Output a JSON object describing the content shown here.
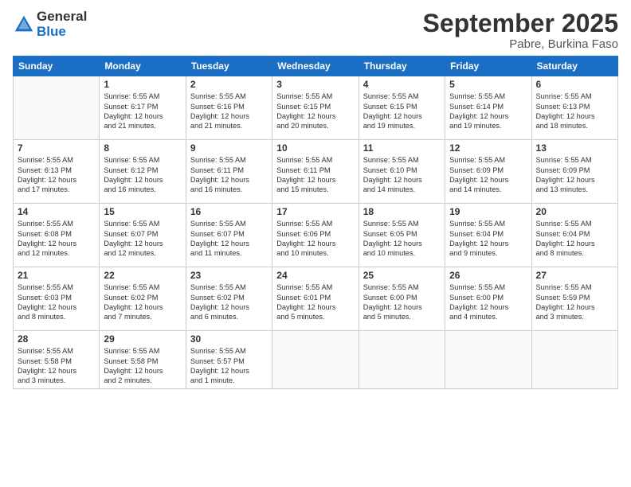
{
  "logo": {
    "general": "General",
    "blue": "Blue"
  },
  "header": {
    "month": "September 2025",
    "location": "Pabre, Burkina Faso"
  },
  "weekdays": [
    "Sunday",
    "Monday",
    "Tuesday",
    "Wednesday",
    "Thursday",
    "Friday",
    "Saturday"
  ],
  "weeks": [
    [
      {
        "day": "",
        "info": ""
      },
      {
        "day": "1",
        "info": "Sunrise: 5:55 AM\nSunset: 6:17 PM\nDaylight: 12 hours\nand 21 minutes."
      },
      {
        "day": "2",
        "info": "Sunrise: 5:55 AM\nSunset: 6:16 PM\nDaylight: 12 hours\nand 21 minutes."
      },
      {
        "day": "3",
        "info": "Sunrise: 5:55 AM\nSunset: 6:15 PM\nDaylight: 12 hours\nand 20 minutes."
      },
      {
        "day": "4",
        "info": "Sunrise: 5:55 AM\nSunset: 6:15 PM\nDaylight: 12 hours\nand 19 minutes."
      },
      {
        "day": "5",
        "info": "Sunrise: 5:55 AM\nSunset: 6:14 PM\nDaylight: 12 hours\nand 19 minutes."
      },
      {
        "day": "6",
        "info": "Sunrise: 5:55 AM\nSunset: 6:13 PM\nDaylight: 12 hours\nand 18 minutes."
      }
    ],
    [
      {
        "day": "7",
        "info": "Sunrise: 5:55 AM\nSunset: 6:13 PM\nDaylight: 12 hours\nand 17 minutes."
      },
      {
        "day": "8",
        "info": "Sunrise: 5:55 AM\nSunset: 6:12 PM\nDaylight: 12 hours\nand 16 minutes."
      },
      {
        "day": "9",
        "info": "Sunrise: 5:55 AM\nSunset: 6:11 PM\nDaylight: 12 hours\nand 16 minutes."
      },
      {
        "day": "10",
        "info": "Sunrise: 5:55 AM\nSunset: 6:11 PM\nDaylight: 12 hours\nand 15 minutes."
      },
      {
        "day": "11",
        "info": "Sunrise: 5:55 AM\nSunset: 6:10 PM\nDaylight: 12 hours\nand 14 minutes."
      },
      {
        "day": "12",
        "info": "Sunrise: 5:55 AM\nSunset: 6:09 PM\nDaylight: 12 hours\nand 14 minutes."
      },
      {
        "day": "13",
        "info": "Sunrise: 5:55 AM\nSunset: 6:09 PM\nDaylight: 12 hours\nand 13 minutes."
      }
    ],
    [
      {
        "day": "14",
        "info": "Sunrise: 5:55 AM\nSunset: 6:08 PM\nDaylight: 12 hours\nand 12 minutes."
      },
      {
        "day": "15",
        "info": "Sunrise: 5:55 AM\nSunset: 6:07 PM\nDaylight: 12 hours\nand 12 minutes."
      },
      {
        "day": "16",
        "info": "Sunrise: 5:55 AM\nSunset: 6:07 PM\nDaylight: 12 hours\nand 11 minutes."
      },
      {
        "day": "17",
        "info": "Sunrise: 5:55 AM\nSunset: 6:06 PM\nDaylight: 12 hours\nand 10 minutes."
      },
      {
        "day": "18",
        "info": "Sunrise: 5:55 AM\nSunset: 6:05 PM\nDaylight: 12 hours\nand 10 minutes."
      },
      {
        "day": "19",
        "info": "Sunrise: 5:55 AM\nSunset: 6:04 PM\nDaylight: 12 hours\nand 9 minutes."
      },
      {
        "day": "20",
        "info": "Sunrise: 5:55 AM\nSunset: 6:04 PM\nDaylight: 12 hours\nand 8 minutes."
      }
    ],
    [
      {
        "day": "21",
        "info": "Sunrise: 5:55 AM\nSunset: 6:03 PM\nDaylight: 12 hours\nand 8 minutes."
      },
      {
        "day": "22",
        "info": "Sunrise: 5:55 AM\nSunset: 6:02 PM\nDaylight: 12 hours\nand 7 minutes."
      },
      {
        "day": "23",
        "info": "Sunrise: 5:55 AM\nSunset: 6:02 PM\nDaylight: 12 hours\nand 6 minutes."
      },
      {
        "day": "24",
        "info": "Sunrise: 5:55 AM\nSunset: 6:01 PM\nDaylight: 12 hours\nand 5 minutes."
      },
      {
        "day": "25",
        "info": "Sunrise: 5:55 AM\nSunset: 6:00 PM\nDaylight: 12 hours\nand 5 minutes."
      },
      {
        "day": "26",
        "info": "Sunrise: 5:55 AM\nSunset: 6:00 PM\nDaylight: 12 hours\nand 4 minutes."
      },
      {
        "day": "27",
        "info": "Sunrise: 5:55 AM\nSunset: 5:59 PM\nDaylight: 12 hours\nand 3 minutes."
      }
    ],
    [
      {
        "day": "28",
        "info": "Sunrise: 5:55 AM\nSunset: 5:58 PM\nDaylight: 12 hours\nand 3 minutes."
      },
      {
        "day": "29",
        "info": "Sunrise: 5:55 AM\nSunset: 5:58 PM\nDaylight: 12 hours\nand 2 minutes."
      },
      {
        "day": "30",
        "info": "Sunrise: 5:55 AM\nSunset: 5:57 PM\nDaylight: 12 hours\nand 1 minute."
      },
      {
        "day": "",
        "info": ""
      },
      {
        "day": "",
        "info": ""
      },
      {
        "day": "",
        "info": ""
      },
      {
        "day": "",
        "info": ""
      }
    ]
  ]
}
